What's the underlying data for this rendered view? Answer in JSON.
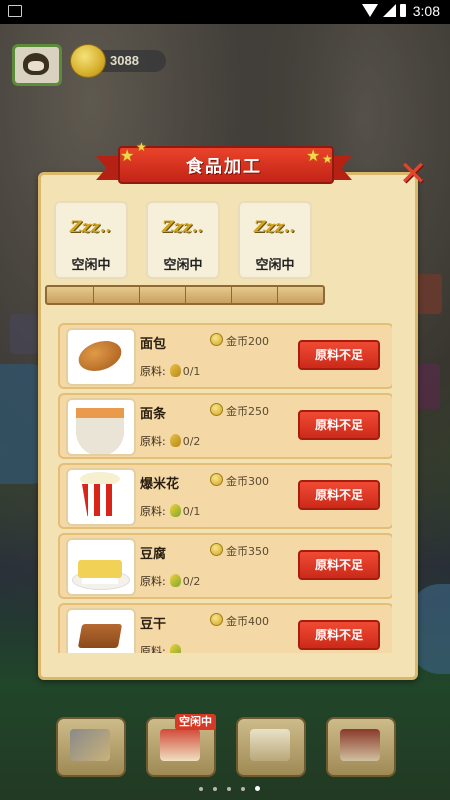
{
  "status_bar": {
    "time": "3:08"
  },
  "hud": {
    "coins": "3088"
  },
  "dialog": {
    "title": "食品加工",
    "slots": [
      {
        "state": "Zzz..",
        "label": "空闲中"
      },
      {
        "state": "Zzz..",
        "label": "空闲中"
      },
      {
        "state": "Zzz..",
        "label": "空闲中"
      }
    ],
    "recipes": [
      {
        "name": "面包",
        "price": "金币200",
        "material_label": "原料:",
        "material_count": "0/1",
        "material_icon": "wheat-icon",
        "button": "原料不足"
      },
      {
        "name": "面条",
        "price": "金币250",
        "material_label": "原料:",
        "material_count": "0/2",
        "material_icon": "wheat-icon",
        "button": "原料不足"
      },
      {
        "name": "爆米花",
        "price": "金币300",
        "material_label": "原料:",
        "material_count": "0/1",
        "material_icon": "corn-icon",
        "button": "原料不足"
      },
      {
        "name": "豆腐",
        "price": "金币350",
        "material_label": "原料:",
        "material_count": "0/2",
        "material_icon": "soybean-icon",
        "button": "原料不足"
      },
      {
        "name": "豆干",
        "price": "金币400",
        "material_label": "原料:",
        "material_count": "",
        "material_icon": "soybean-icon",
        "button": "原料不足"
      }
    ]
  },
  "bottom_bar": {
    "idle_tag": "空闲中"
  },
  "colors": {
    "accent_red": "#d63a26",
    "panel": "#f3e2b4",
    "row": "#f4d9a6"
  }
}
